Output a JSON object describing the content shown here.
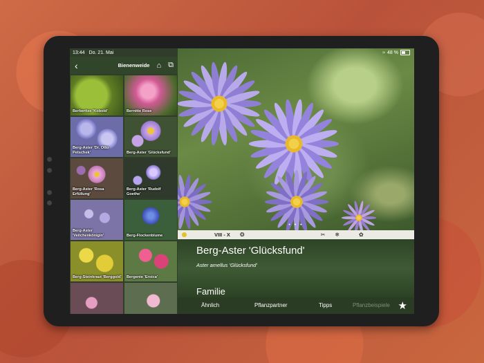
{
  "status_bar": {
    "time": "13:44",
    "date": "Do. 21. Mai",
    "battery": "48 %"
  },
  "nav": {
    "back_icon": "chevron-left-icon",
    "title": "Bienenweide",
    "home_icon": "home-icon",
    "copy_icon": "copy-icon"
  },
  "plants": [
    {
      "label": "Berberitze 'Kobold'"
    },
    {
      "label": "Bernitte Rose"
    },
    {
      "label": "Berg-Aster 'Dr. Otto Petschek'"
    },
    {
      "label": "Berg-Aster 'Glücksfund'"
    },
    {
      "label": "Berg-Aster 'Rosa Erfüllung'"
    },
    {
      "label": "Berg-Aster 'Rudolf Goethe'"
    },
    {
      "label": "Berg-Aster 'Veilchenkönigin'"
    },
    {
      "label": "Berg-Flockenblume"
    },
    {
      "label": "Berg-Steinkraut 'Berggold'"
    },
    {
      "label": "Bergenie 'Eroica'"
    },
    {
      "label": ""
    },
    {
      "label": ""
    }
  ],
  "photo": {
    "pager": "• • •"
  },
  "calendar": {
    "sun_icon": "sun-icon",
    "period": "VIII - X",
    "icons": [
      "bee-icon",
      "scissors-icon",
      "snowflake-icon",
      "insect-icon"
    ]
  },
  "detail": {
    "name": "Berg-Aster 'Glücksfund'",
    "latin": "Aster amellus 'Glücksfund'",
    "section": "Familie"
  },
  "tabs": {
    "similar": "Ähnlich",
    "partner": "Pflanzpartner",
    "tips": "Tipps",
    "examples": "Pflanzbeispiele",
    "star_icon": "star-icon"
  }
}
